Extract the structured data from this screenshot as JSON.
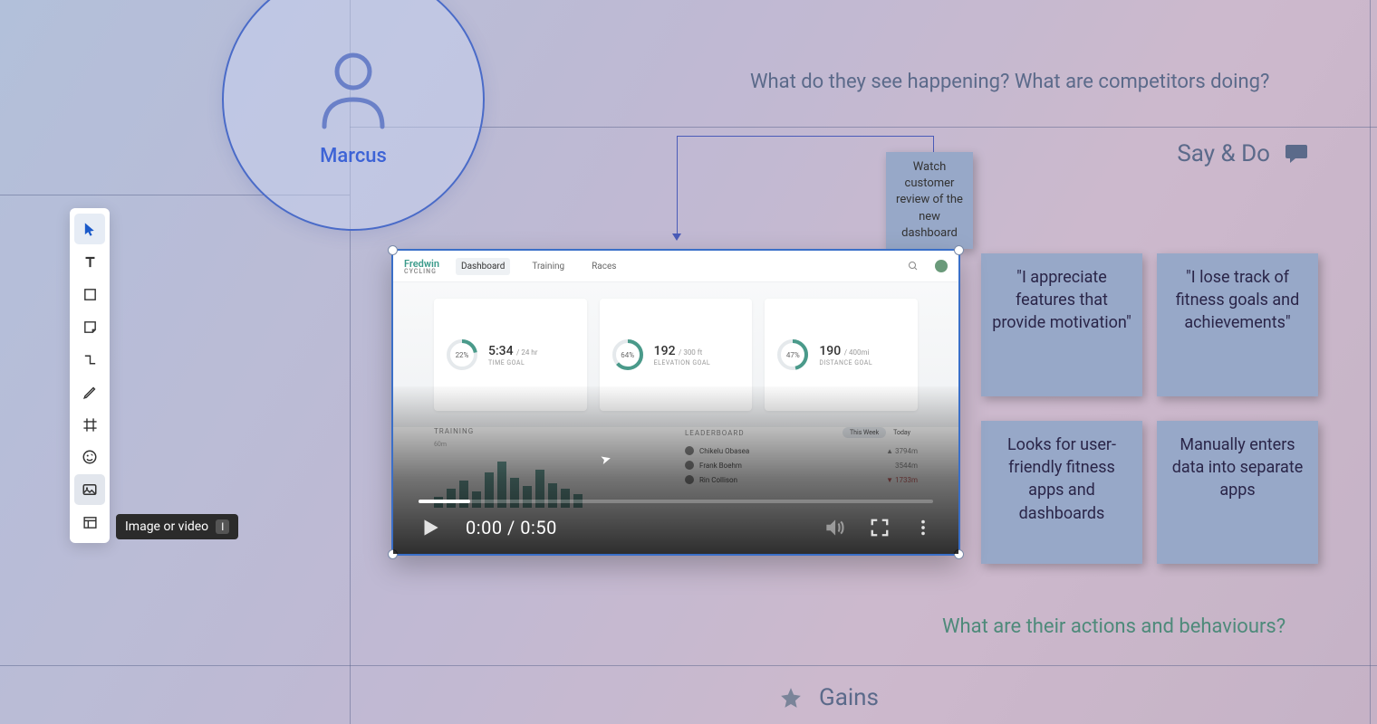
{
  "persona": {
    "name": "Marcus"
  },
  "sections": {
    "see_prompt": "What do they see happening? What are competitors doing?",
    "say_do_label": "Say & Do",
    "behave_prompt": "What are their actions and behaviours?",
    "gains_label": "Gains"
  },
  "toolbar": {
    "tooltip_label": "Image or video",
    "tooltip_key": "I"
  },
  "arrow_note": "Watch customer review of the new dashboard",
  "stickies": {
    "s1": "\"I appreciate features that provide motivation\"",
    "s2": "\"I lose track of fitness goals and achievements\"",
    "s3": "Looks for user-friendly fitness apps and dashboards",
    "s4": "Manually enters data into separate apps"
  },
  "video": {
    "brand_top": "Fredwin",
    "brand_bottom": "CYCLING",
    "tabs": {
      "dashboard": "Dashboard",
      "training": "Training",
      "races": "Races"
    },
    "cards": {
      "time": {
        "pct": "22%",
        "value": "5:34",
        "unit": "/ 24 hr",
        "label": "TIME GOAL"
      },
      "elev": {
        "pct": "64%",
        "value": "192",
        "unit": "/ 300 ft",
        "label": "ELEVATION GOAL"
      },
      "dist": {
        "pct": "47%",
        "value": "190",
        "unit": "/ 400mi",
        "label": "DISTANCE GOAL"
      }
    },
    "lower": {
      "training_label": "TRAINING",
      "leaderboard_label": "LEADERBOARD",
      "this_week": "This Week",
      "today": "Today",
      "leaders": [
        {
          "name": "Chikelu Obasea",
          "dist": "3794m"
        },
        {
          "name": "Frank Boehm",
          "dist": "3544m"
        },
        {
          "name": "Rin Collison",
          "dist": "1733m"
        }
      ]
    },
    "time_display": "0:00 / 0:50"
  }
}
